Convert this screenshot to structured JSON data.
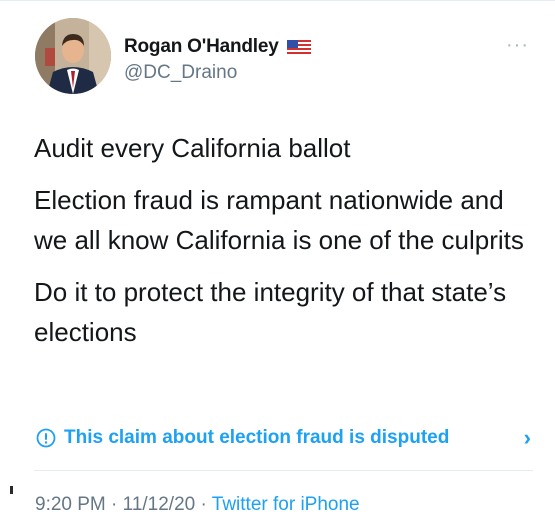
{
  "user": {
    "display_name": "Rogan O'Handley",
    "handle": "@DC_Draino",
    "flag_icon": "us-flag-icon"
  },
  "more_label": "···",
  "tweet": {
    "paragraphs": [
      "Audit every California ballot",
      "Election fraud is rampant nationwide and we all know California is one of the culprits",
      "Do it to protect the integrity of that state’s elections"
    ]
  },
  "notice": {
    "text": "This claim about election fraud is disputed",
    "chevron": "›",
    "icon": "exclamation-circle-icon"
  },
  "meta": {
    "time": "9:20 PM",
    "separator1": " · ",
    "date": "11/12/20",
    "separator2": " · ",
    "source": "Twitter for iPhone"
  },
  "colors": {
    "link_blue": "#1da1f2",
    "secondary_gray": "#657786",
    "text": "#14171a"
  }
}
